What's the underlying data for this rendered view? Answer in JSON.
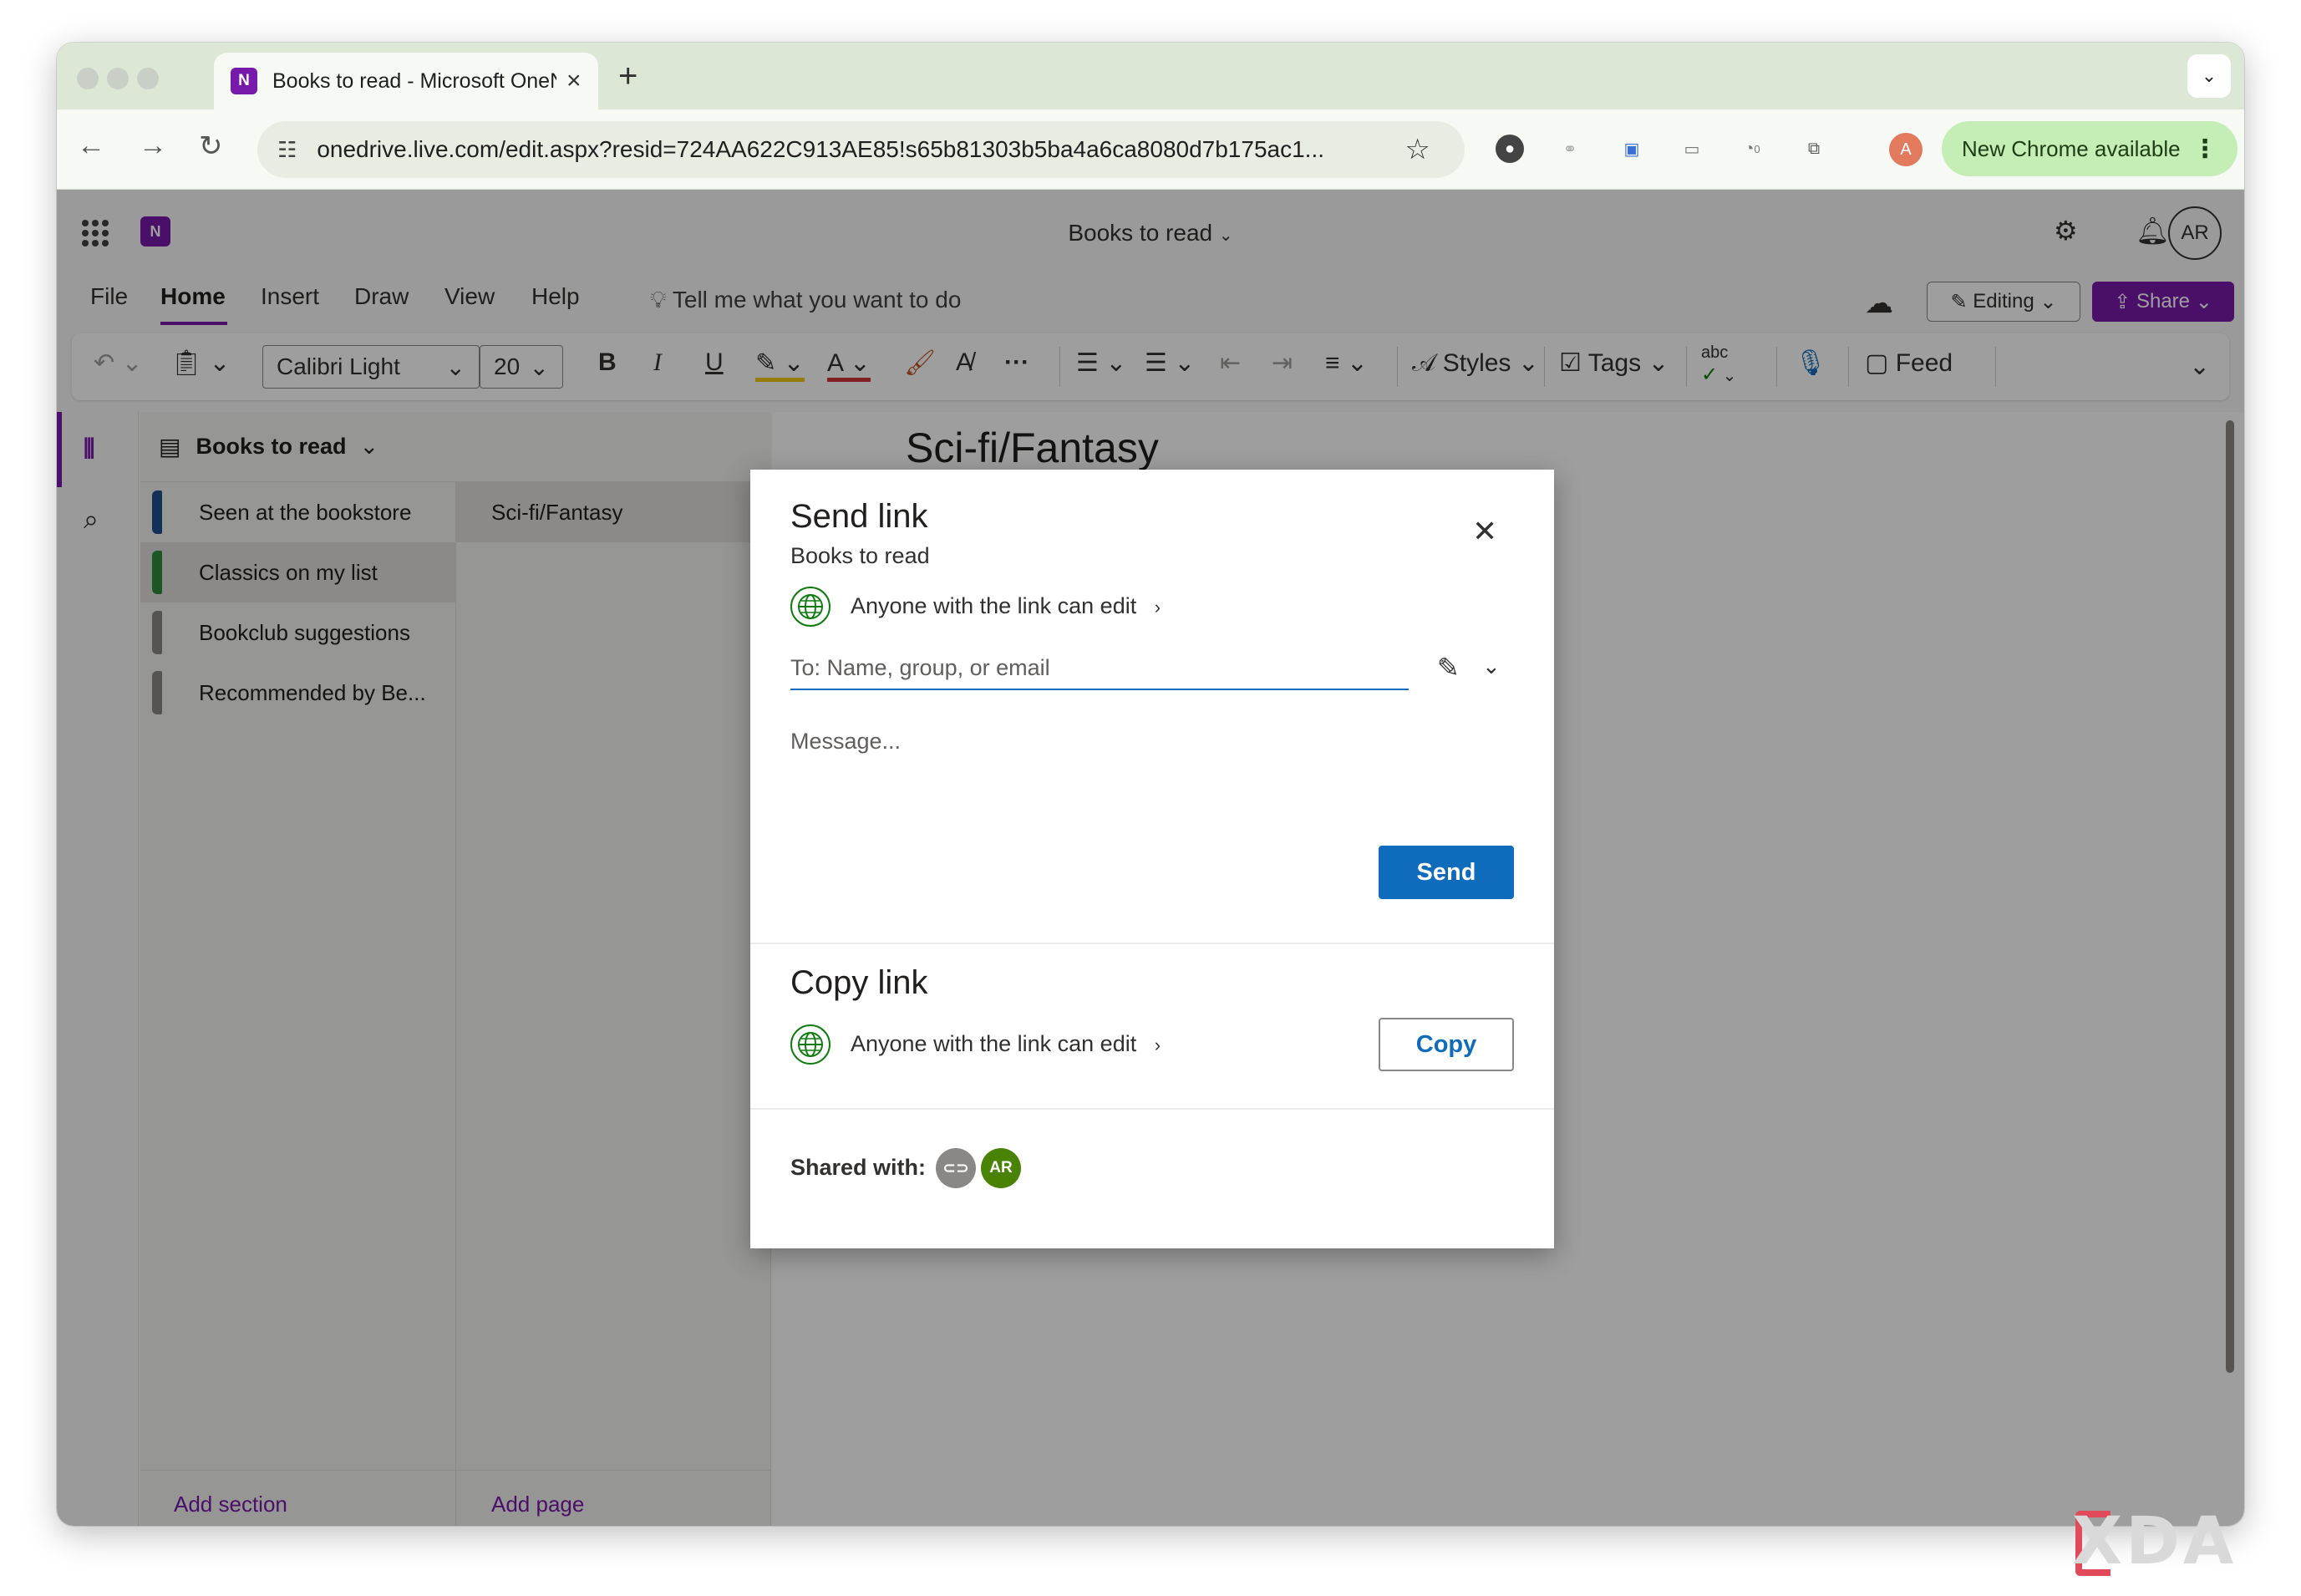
{
  "browser": {
    "tab_title": "Books to read - Microsoft OneNote",
    "tab_favicon": "N",
    "url": "onedrive.live.com/edit.aspx?resid=724AA622C913AE85!s65b81303b5ba4a6ca8080d7b175ac1...",
    "profile_initial": "A",
    "chrome_available": "New Chrome available",
    "extension_badge": "0"
  },
  "app": {
    "logo_letter": "N",
    "doc_title": "Books to read",
    "avatar": "AR",
    "menu": [
      "File",
      "Home",
      "Insert",
      "Draw",
      "View",
      "Help"
    ],
    "tell_me": "Tell me what you want to do",
    "editing_label": "Editing",
    "share_label": "Share",
    "ribbon": {
      "font_name": "Calibri Light",
      "font_size": "20",
      "styles_label": "Styles",
      "tags_label": "Tags",
      "spell_label": "abc",
      "feed_label": "Feed"
    },
    "notebook_name": "Books to read",
    "sections": [
      {
        "label": "Seen at the bookstore",
        "color": "#1f4e8c"
      },
      {
        "label": "Classics on my list",
        "color": "#2e8b3a"
      },
      {
        "label": "Bookclub suggestions",
        "color": "#8a8886"
      },
      {
        "label": "Recommended by Be...",
        "color": "#8a8886"
      }
    ],
    "pages": [
      "Sci-fi/Fantasy"
    ],
    "add_section": "Add section",
    "add_page": "Add page",
    "page_title": "Sci-fi/Fantasy"
  },
  "dialog": {
    "title": "Send link",
    "subtitle": "Books to read",
    "permission": "Anyone with the link can edit",
    "to_placeholder": "To: Name, group, or email",
    "message_placeholder": "Message...",
    "send_label": "Send",
    "copy_title": "Copy link",
    "copy_permission": "Anyone with the link can edit",
    "copy_label": "Copy",
    "shared_with_label": "Shared with:",
    "shared_avatar": "AR"
  },
  "colors": {
    "brand": "#7719aa",
    "primary_button": "#0f6cbd",
    "shared_avatar_bg": "#498205",
    "link_avatar_bg": "#8a8886"
  },
  "watermark": "XDA"
}
